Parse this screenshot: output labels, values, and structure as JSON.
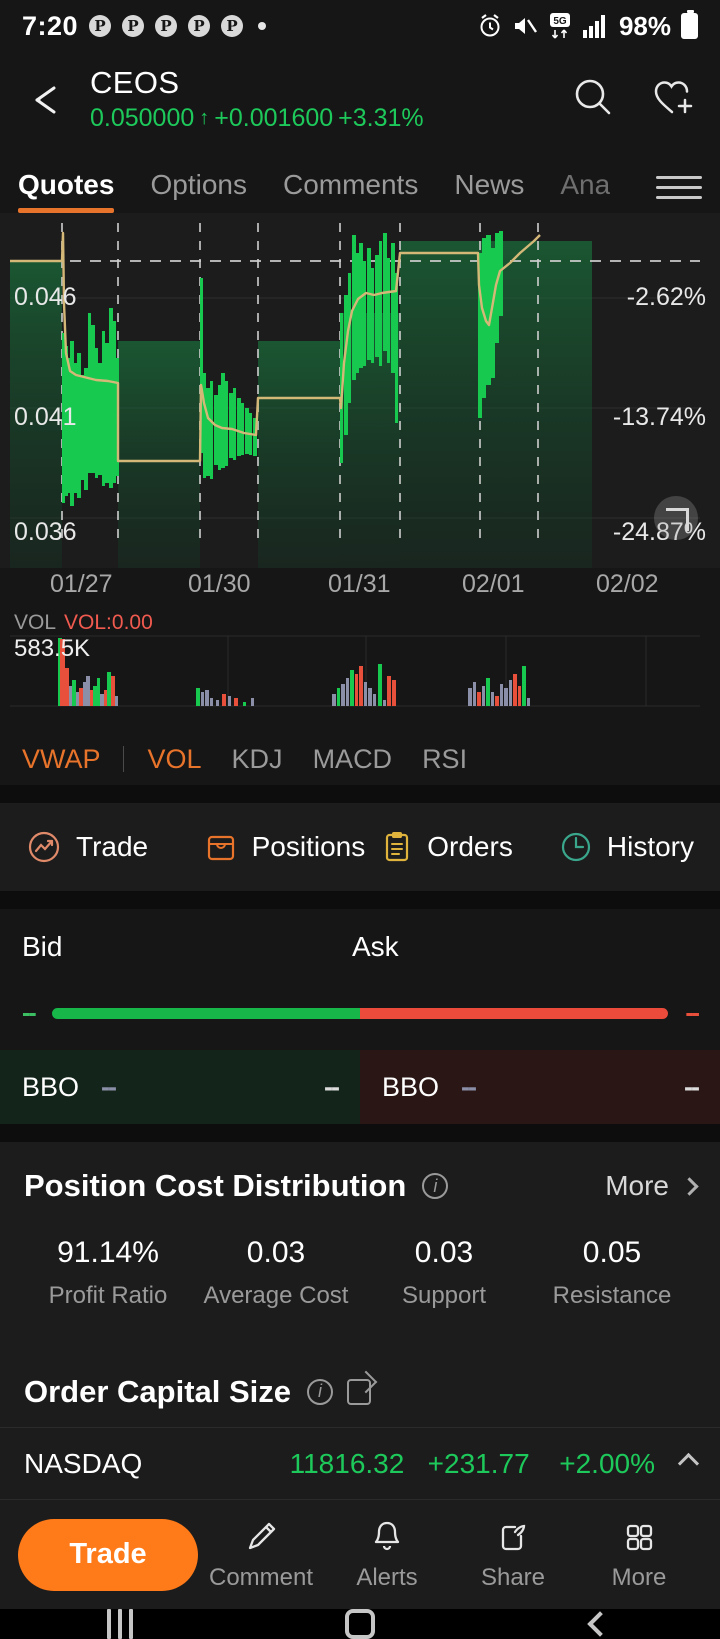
{
  "statusbar": {
    "time": "7:20",
    "notification_icons": [
      "pinterest-icon",
      "pinterest-icon",
      "pinterest-icon",
      "pinterest-icon",
      "pinterest-icon",
      "dot-icon"
    ],
    "alarm_icon": "alarm-icon",
    "mute_icon": "mute-icon",
    "network": "5G",
    "signal_icon": "signal-bars-icon",
    "battery_percent": "98%"
  },
  "header": {
    "back_icon": "back-arrow-icon",
    "ticker": "CEOS",
    "price": "0.050000",
    "arrow": "↑",
    "change": "+0.001600",
    "change_percent": "+3.31%",
    "search_icon": "search-icon",
    "watchlist_icon": "heart-plus-icon",
    "up_color": "#1ec95b"
  },
  "tabs": {
    "items": [
      {
        "label": "Quotes",
        "active": true
      },
      {
        "label": "Options",
        "active": false
      },
      {
        "label": "Comments",
        "active": false
      },
      {
        "label": "News",
        "active": false
      },
      {
        "label": "Ana",
        "active": false
      }
    ],
    "menu_icon": "hamburger-menu-icon",
    "accent": "#e8732a"
  },
  "chart_data": {
    "type": "line",
    "title": "CEOS intraday price chart",
    "y_axis_left": [
      "0.046",
      "0.041",
      "0.036"
    ],
    "y_axis_right": [
      "-2.62%",
      "-13.74%",
      "-24.87%"
    ],
    "x_axis": [
      "01/27",
      "01/30",
      "01/31",
      "02/01",
      "02/02"
    ],
    "ylim": [
      0.036,
      0.0505
    ],
    "right_ylim": [
      -24.87,
      0.0
    ],
    "grid": true,
    "series": [
      {
        "name": "Price",
        "color": "#17c94f"
      },
      {
        "name": "VWAP",
        "color": "#d4b878"
      }
    ],
    "expand_icon": "fullscreen-expand-icon"
  },
  "volume": {
    "label": "VOL",
    "value": "VOL:0.00",
    "max": "583.5K",
    "value_color": "#f05a4f"
  },
  "indicators": {
    "items": [
      {
        "label": "VWAP",
        "on": true
      },
      {
        "label": "VOL",
        "on": true
      },
      {
        "label": "KDJ",
        "on": false
      },
      {
        "label": "MACD",
        "on": false
      },
      {
        "label": "RSI",
        "on": false
      }
    ]
  },
  "trade_row": {
    "items": [
      {
        "label": "Trade",
        "icon": "trade-chart-circle-icon",
        "color": "#e08a6a"
      },
      {
        "label": "Positions",
        "icon": "briefcase-icon",
        "color": "#e8732a"
      },
      {
        "label": "Orders",
        "icon": "clipboard-icon",
        "color": "#e0b43c"
      },
      {
        "label": "History",
        "icon": "clock-icon",
        "color": "#3aa68c"
      }
    ]
  },
  "bidask": {
    "bid_label": "Bid",
    "ask_label": "Ask",
    "bid_dash": "--",
    "ask_dash": "--",
    "bbo_label": "BBO",
    "bid_bbo_value": "--",
    "bid_bbo_size": "--",
    "ask_bbo_value": "--",
    "ask_bbo_size": "--",
    "bid_color": "#17b74a",
    "ask_color": "#ea4b3b"
  },
  "position_cost": {
    "title": "Position Cost Distribution",
    "info_icon": "info-icon",
    "more_label": "More",
    "chevron_icon": "chevron-right-icon",
    "stats": [
      {
        "value": "91.14%",
        "label": "Profit Ratio"
      },
      {
        "value": "0.03",
        "label": "Average Cost"
      },
      {
        "value": "0.03",
        "label": "Support"
      },
      {
        "value": "0.05",
        "label": "Resistance"
      }
    ]
  },
  "order_capital": {
    "title": "Order Capital Size",
    "info_icon": "info-icon",
    "share_icon": "share-icon"
  },
  "index_row": {
    "name": "NASDAQ",
    "value": "11816.32",
    "change": "+231.77",
    "change_percent": "+2.00%",
    "chevron_icon": "chevron-up-icon",
    "color": "#1ec95b"
  },
  "bottom_bar": {
    "trade_label": "Trade",
    "trade_color": "#ff7a18",
    "items": [
      {
        "label": "Comment",
        "icon": "pencil-icon"
      },
      {
        "label": "Alerts",
        "icon": "bell-icon"
      },
      {
        "label": "Share",
        "icon": "share-box-icon"
      },
      {
        "label": "More",
        "icon": "grid-four-squares-icon"
      }
    ]
  },
  "android_nav": {
    "recents_icon": "recents-icon",
    "home_icon": "home-icon",
    "back_icon": "back-icon"
  }
}
